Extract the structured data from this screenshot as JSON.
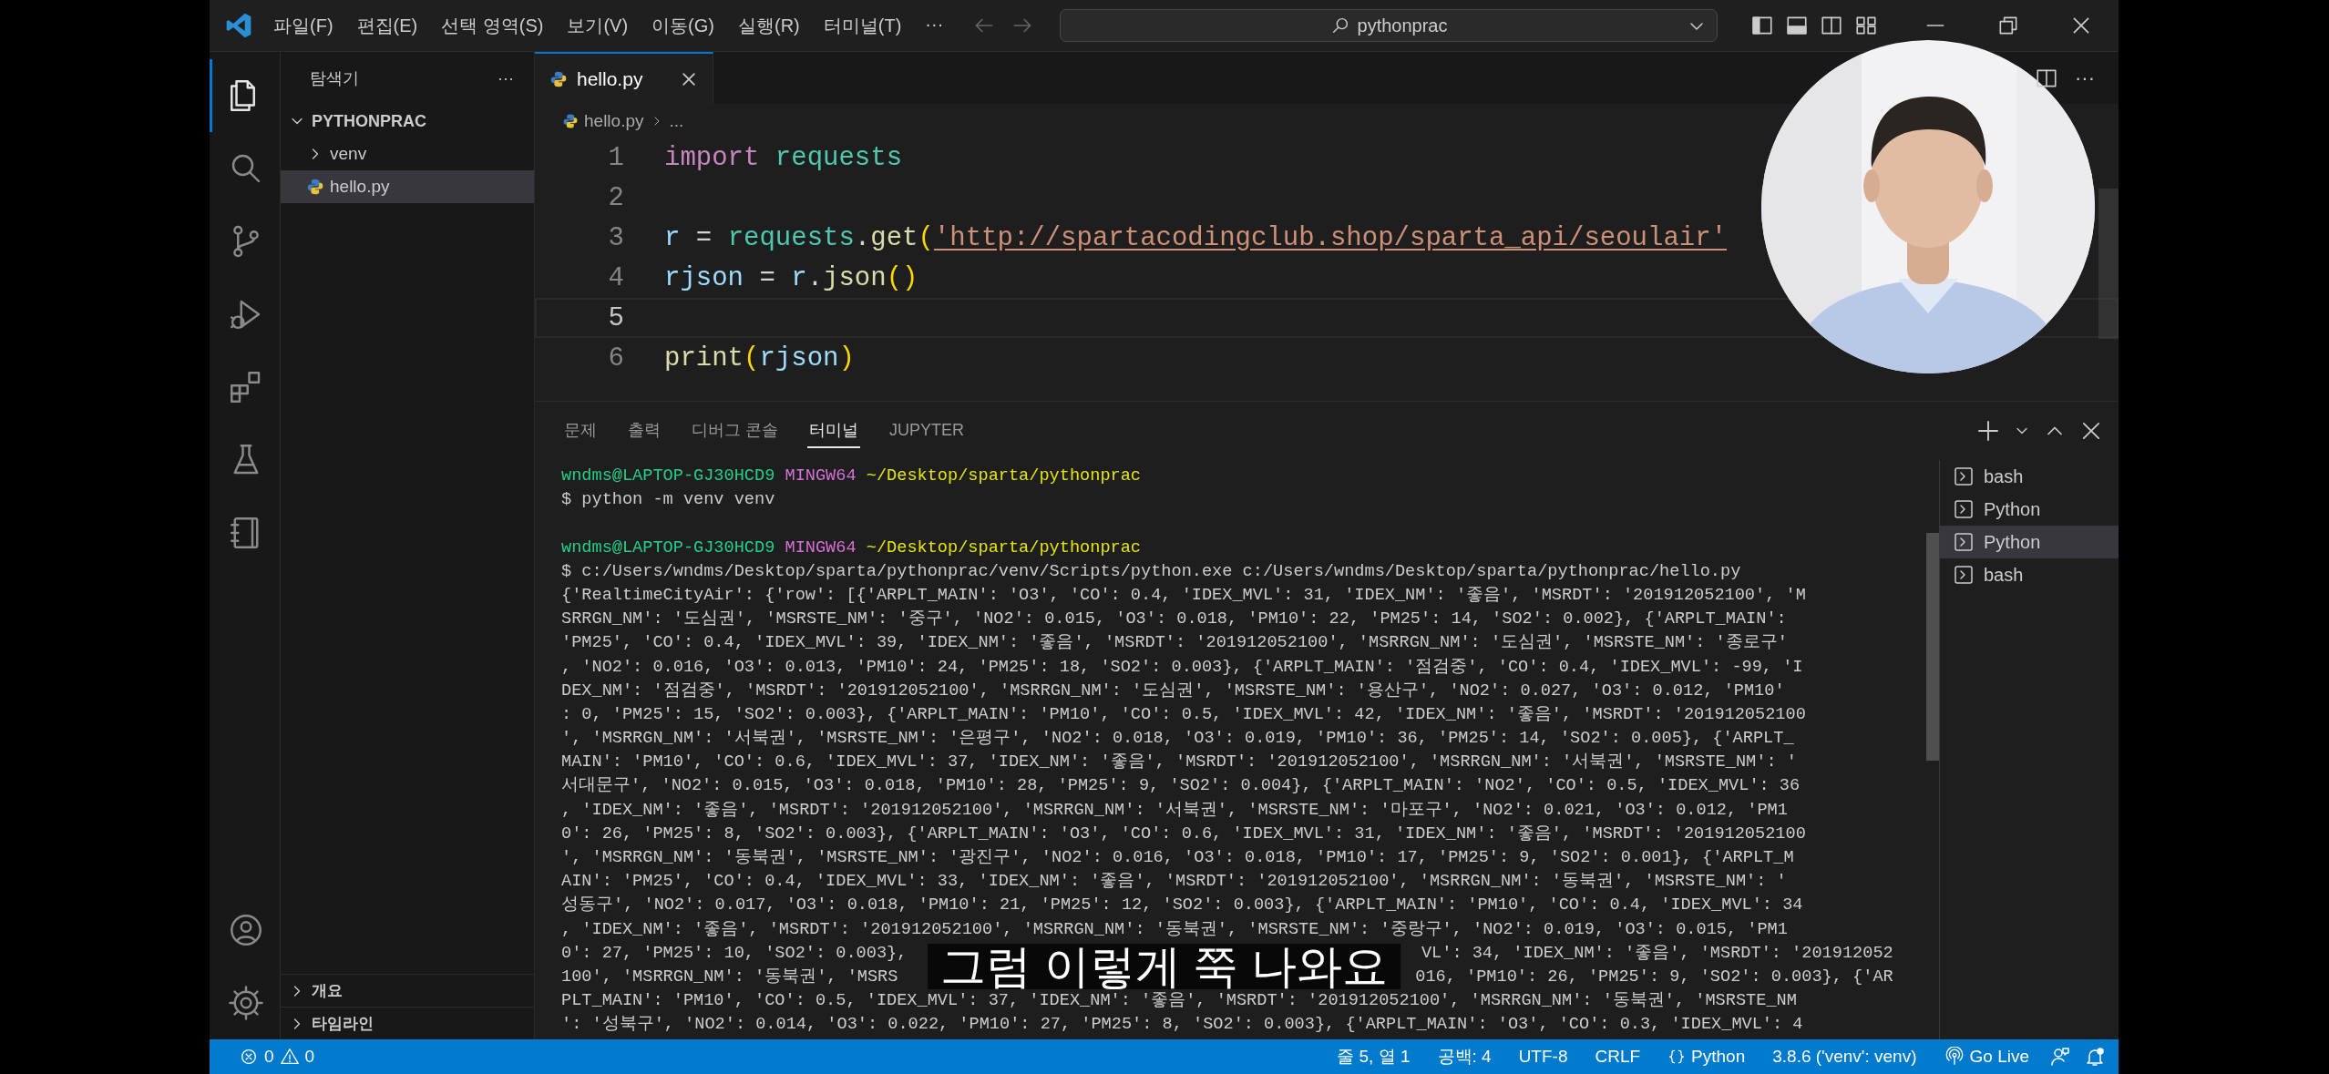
{
  "title_bar": {
    "menus": [
      "파일(F)",
      "편집(E)",
      "선택 영역(S)",
      "보기(V)",
      "이동(G)",
      "실행(R)",
      "터미널(T)"
    ],
    "more": "···",
    "search": {
      "value": "pythonprac"
    }
  },
  "activity_bar": {
    "items": [
      {
        "kind": "explorer",
        "selected": true
      },
      {
        "kind": "search",
        "selected": false
      },
      {
        "kind": "source-control",
        "selected": false
      },
      {
        "kind": "run-debug",
        "selected": false
      },
      {
        "kind": "extensions",
        "selected": false
      },
      {
        "kind": "testing",
        "selected": false
      },
      {
        "kind": "notebook",
        "selected": false
      }
    ],
    "bottom": [
      {
        "kind": "account"
      },
      {
        "kind": "settings"
      }
    ]
  },
  "sidebar": {
    "title": "탐색기",
    "more": "···",
    "folder": {
      "label": "PYTHONPRAC",
      "expanded": true,
      "children": [
        {
          "label": "venv",
          "kind": "folder",
          "expanded": false,
          "selected": false
        },
        {
          "label": "hello.py",
          "kind": "python",
          "selected": true
        }
      ]
    },
    "sections": [
      {
        "label": "개요",
        "expanded": false
      },
      {
        "label": "타임라인",
        "expanded": false
      }
    ]
  },
  "editor": {
    "tabs": [
      {
        "label": "hello.py",
        "selected": true
      }
    ],
    "more": "···",
    "breadcrumb": {
      "file": "hello.py",
      "rest": "..."
    },
    "lines": [
      {
        "number": "1",
        "current": false,
        "tokens": [
          {
            "kind": "keyword",
            "text": "import "
          },
          {
            "kind": "module",
            "text": "requests"
          }
        ]
      },
      {
        "number": "2",
        "current": false
      },
      {
        "number": "3",
        "current": false,
        "tokens": [
          {
            "kind": "variable",
            "text": "r"
          },
          {
            "kind": "plain",
            "text": " = "
          },
          {
            "kind": "module",
            "text": "requests"
          },
          {
            "kind": "plain",
            "text": "."
          },
          {
            "kind": "function",
            "text": "get"
          },
          {
            "kind": "bracket",
            "text": "("
          },
          {
            "kind": "string",
            "text": "'http://spartacodingclub.shop/sparta_api/seoulair'"
          }
        ]
      },
      {
        "number": "4",
        "current": false,
        "tokens": [
          {
            "kind": "variable",
            "text": "rjson"
          },
          {
            "kind": "plain",
            "text": " = "
          },
          {
            "kind": "variable",
            "text": "r"
          },
          {
            "kind": "plain",
            "text": "."
          },
          {
            "kind": "function",
            "text": "json"
          },
          {
            "kind": "bracket",
            "text": "()"
          }
        ]
      },
      {
        "number": "5",
        "current": true
      },
      {
        "number": "6",
        "current": false,
        "tokens": [
          {
            "kind": "function",
            "text": "print"
          },
          {
            "kind": "bracket",
            "text": "("
          },
          {
            "kind": "variable",
            "text": "rjson"
          },
          {
            "kind": "bracket",
            "text": ")"
          }
        ]
      }
    ]
  },
  "panel": {
    "tabs": [
      {
        "label": "문제",
        "selected": false
      },
      {
        "label": "출력",
        "selected": false
      },
      {
        "label": "디버그 콘솔",
        "selected": false
      },
      {
        "label": "터미널",
        "selected": true
      },
      {
        "label": "JUPYTER",
        "selected": false
      }
    ],
    "terminal_lines": [
      {
        "kind": "prompt",
        "user": "wndms@LAPTOP-GJ30HCD9",
        "shell": "MINGW64",
        "path": "~/Desktop/sparta/pythonprac"
      },
      {
        "kind": "text",
        "text": "$ python -m venv venv"
      },
      {
        "kind": "blank"
      },
      {
        "kind": "prompt",
        "user": "wndms@LAPTOP-GJ30HCD9",
        "shell": "MINGW64",
        "path": "~/Desktop/sparta/pythonprac"
      },
      {
        "kind": "text",
        "text": "$ c:/Users/wndms/Desktop/sparta/pythonprac/venv/Scripts/python.exe c:/Users/wndms/Desktop/sparta/pythonprac/hello.py"
      },
      {
        "kind": "text",
        "text": "{'RealtimeCityAir': {'row': [{'ARPLT_MAIN': 'O3', 'CO': 0.4, 'IDEX_MVL': 31, 'IDEX_NM': '좋음', 'MSRDT': '201912052100', 'M"
      },
      {
        "kind": "text",
        "text": "SRRGN_NM': '도심권', 'MSRSTE_NM': '중구', 'NO2': 0.015, 'O3': 0.018, 'PM10': 22, 'PM25': 14, 'SO2': 0.002}, {'ARPLT_MAIN':"
      },
      {
        "kind": "text",
        "text": "'PM25', 'CO': 0.4, 'IDEX_MVL': 39, 'IDEX_NM': '좋음', 'MSRDT': '201912052100', 'MSRRGN_NM': '도심권', 'MSRSTE_NM': '종로구'"
      },
      {
        "kind": "text",
        "text": ", 'NO2': 0.016, 'O3': 0.013, 'PM10': 24, 'PM25': 18, 'SO2': 0.003}, {'ARPLT_MAIN': '점검중', 'CO': 0.4, 'IDEX_MVL': -99, 'I"
      },
      {
        "kind": "text",
        "text": "DEX_NM': '점검중', 'MSRDT': '201912052100', 'MSRRGN_NM': '도심권', 'MSRSTE_NM': '용산구', 'NO2': 0.027, 'O3': 0.012, 'PM10'"
      },
      {
        "kind": "text",
        "text": ": 0, 'PM25': 15, 'SO2': 0.003}, {'ARPLT_MAIN': 'PM10', 'CO': 0.5, 'IDEX_MVL': 42, 'IDEX_NM': '좋음', 'MSRDT': '201912052100"
      },
      {
        "kind": "text",
        "text": "', 'MSRRGN_NM': '서북권', 'MSRSTE_NM': '은평구', 'NO2': 0.018, 'O3': 0.019, 'PM10': 36, 'PM25': 14, 'SO2': 0.005}, {'ARPLT_"
      },
      {
        "kind": "text",
        "text": "MAIN': 'PM10', 'CO': 0.6, 'IDEX_MVL': 37, 'IDEX_NM': '좋음', 'MSRDT': '201912052100', 'MSRRGN_NM': '서북권', 'MSRSTE_NM': '"
      },
      {
        "kind": "text",
        "text": "서대문구', 'NO2': 0.015, 'O3': 0.018, 'PM10': 28, 'PM25': 9, 'SO2': 0.004}, {'ARPLT_MAIN': 'NO2', 'CO': 0.5, 'IDEX_MVL': 36"
      },
      {
        "kind": "text",
        "text": ", 'IDEX_NM': '좋음', 'MSRDT': '201912052100', 'MSRRGN_NM': '서북권', 'MSRSTE_NM': '마포구', 'NO2': 0.021, 'O3': 0.012, 'PM1"
      },
      {
        "kind": "text",
        "text": "0': 26, 'PM25': 8, 'SO2': 0.003}, {'ARPLT_MAIN': 'O3', 'CO': 0.6, 'IDEX_MVL': 31, 'IDEX_NM': '좋음', 'MSRDT': '201912052100"
      },
      {
        "kind": "text",
        "text": "', 'MSRRGN_NM': '동북권', 'MSRSTE_NM': '광진구', 'NO2': 0.016, 'O3': 0.018, 'PM10': 17, 'PM25': 9, 'SO2': 0.001}, {'ARPLT_M"
      },
      {
        "kind": "text",
        "text": "AIN': 'PM25', 'CO': 0.4, 'IDEX_MVL': 33, 'IDEX_NM': '좋음', 'MSRDT': '201912052100', 'MSRRGN_NM': '동북권', 'MSRSTE_NM': '"
      },
      {
        "kind": "text",
        "text": "성동구', 'NO2': 0.017, 'O3': 0.018, 'PM10': 21, 'PM25': 12, 'SO2': 0.003}, {'ARPLT_MAIN': 'PM10', 'CO': 0.4, 'IDEX_MVL': 34"
      },
      {
        "kind": "text",
        "text": ", 'IDEX_NM': '좋음', 'MSRDT': '201912052100', 'MSRRGN_NM': '동북권', 'MSRSTE_NM': '중랑구', 'NO2': 0.019, 'O3': 0.015, 'PM1"
      },
      {
        "kind": "split",
        "left": "0': 27, 'PM25': 10, 'SO2': 0.003},",
        "right": "VL': 34, 'IDEX_NM': '좋음', 'MSRDT': '201912052"
      },
      {
        "kind": "split",
        "left": "100', 'MSRRGN_NM': '동북권', 'MSRS",
        "right": "016, 'PM10': 26, 'PM25': 9, 'SO2': 0.003}, {'AR"
      },
      {
        "kind": "text",
        "text": "PLT_MAIN': 'PM10', 'CO': 0.5, 'IDEX_MVL': 37, 'IDEX_NM': '좋음', 'MSRDT': '201912052100', 'MSRRGN_NM': '동북권', 'MSRSTE_NM"
      },
      {
        "kind": "text",
        "text": "': '성북구', 'NO2': 0.014, 'O3': 0.022, 'PM10': 27, 'PM25': 8, 'SO2': 0.003}, {'ARPLT_MAIN': 'O3', 'CO': 0.3, 'IDEX_MVL': 4"
      }
    ],
    "terminals": [
      {
        "label": "bash",
        "selected": false
      },
      {
        "label": "Python",
        "selected": false
      },
      {
        "label": "Python",
        "selected": true
      },
      {
        "label": "bash",
        "selected": false
      }
    ]
  },
  "status_bar": {
    "errors": "0",
    "warnings": "0",
    "items": [
      "줄 5, 열 1",
      "공백: 4",
      "UTF-8",
      "CRLF"
    ],
    "language": "Python",
    "interpreter": "3.8.6 ('venv': venv)",
    "go_live": "Go Live"
  },
  "subtitle": "그럼 이렇게 쭉 나와요"
}
